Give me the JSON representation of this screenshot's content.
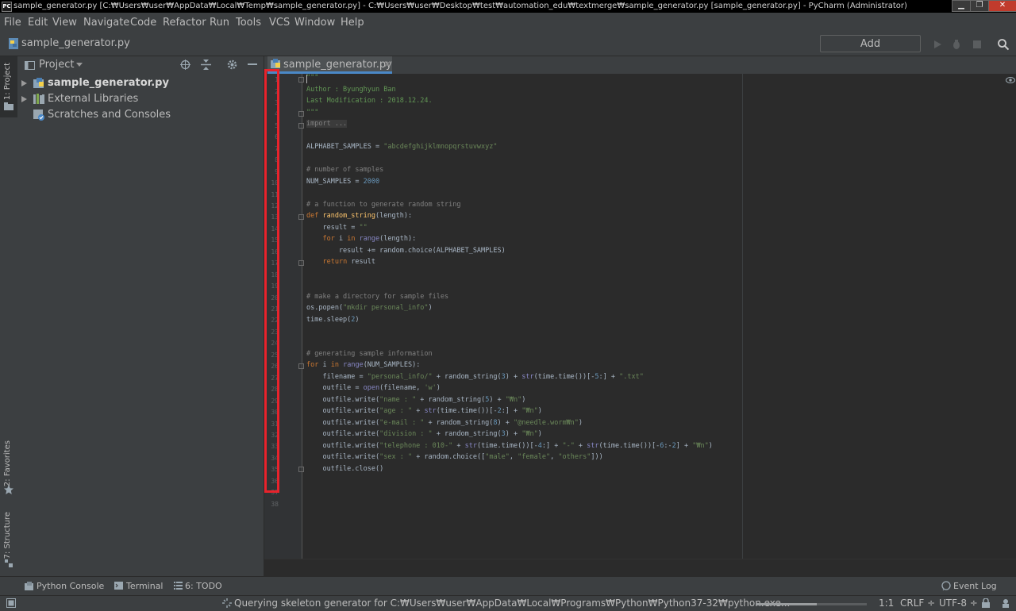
{
  "window": {
    "title": "sample_generator.py [C:₩Users₩user₩AppData₩Local₩Temp₩sample_generator.py] - C:₩Users₩user₩Desktop₩test₩automation_edu₩textmerge₩sample_generator.py [sample_generator.py] - PyCharm (Administrator)",
    "app_icon": "PC",
    "minimize": "▁",
    "maximize": "❐",
    "close": "✕"
  },
  "menu": [
    "File",
    "Edit",
    "View",
    "Navigate",
    "Code",
    "Refactor",
    "Run",
    "Tools",
    "VCS",
    "Window",
    "Help"
  ],
  "navbar": {
    "file": "sample_generator.py",
    "add_configuration": "Add Configuration...",
    "icons": [
      "run-icon",
      "debug-icon",
      "stop-icon",
      "search-icon"
    ]
  },
  "left_strip": {
    "project": "1: Project",
    "favorites": "2: Favorites",
    "structure": "7: Structure"
  },
  "project_panel": {
    "title": "Project",
    "tree": [
      {
        "label": "sample_generator.py",
        "bold": true,
        "icon": "python-file-icon"
      },
      {
        "label": "External Libraries",
        "bold": false,
        "icon": "library-icon"
      },
      {
        "label": "Scratches and Consoles",
        "bold": false,
        "icon": "scratches-icon"
      }
    ]
  },
  "editor": {
    "tab": "sample_generator.py",
    "line_count": 38
  },
  "bottom_tools": {
    "python_console": "Python Console",
    "terminal": "Terminal",
    "todo": "6: TODO",
    "event_log": "Event Log"
  },
  "status": {
    "message": "Querying skeleton generator for C:₩Users₩user₩AppData₩Local₩Programs₩Python₩Python37-32₩python.exe...",
    "position": "1:1",
    "line_ending": "CRLF ÷",
    "encoding": "UTF-8 ÷",
    "progress": 0.55
  },
  "colors": {
    "background": "#2b2b2b",
    "panel": "#3c3f41",
    "highlight_box": "#e8232c",
    "tab_underline": "#4a88c7"
  }
}
